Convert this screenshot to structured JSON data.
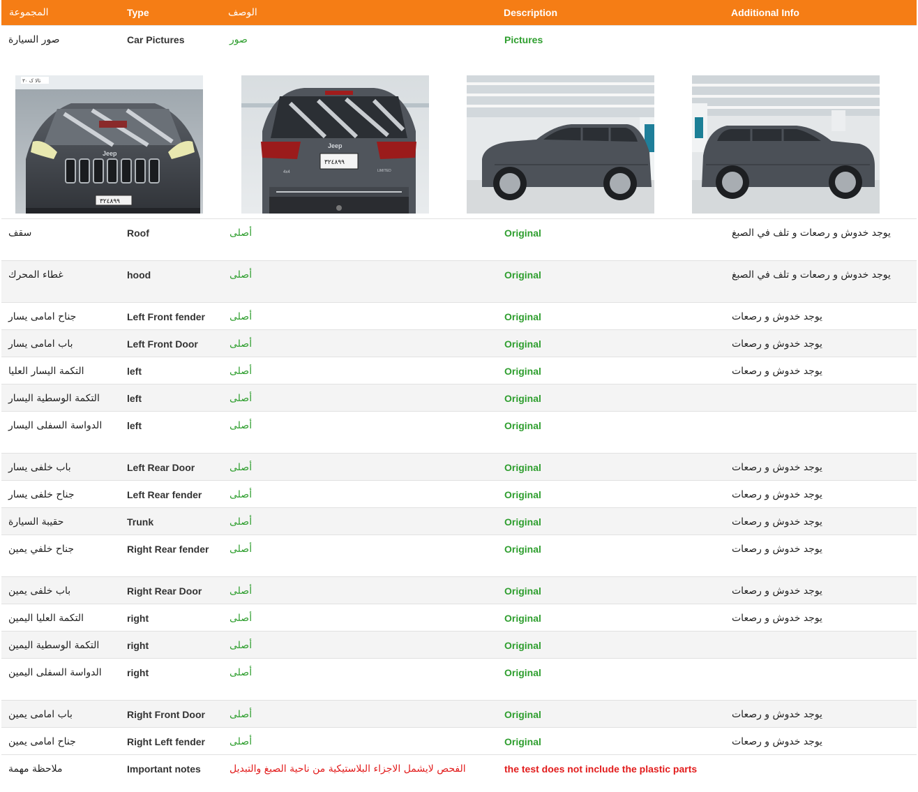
{
  "header": {
    "col_group": "المجموعة",
    "col_type": "Type",
    "col_desc_ar": "الوصف",
    "col_desc_en": "Description",
    "col_info": "Additional Info"
  },
  "pictures_row": {
    "group": "صور السيارة",
    "type": "Car Pictures",
    "desc_ar": "صور",
    "desc_en": "Pictures"
  },
  "photos": {
    "front": {
      "badge": "Jeep",
      "plate": "٣٢٤٨٩٩",
      "corner_text": "تالا ک ٣٠"
    },
    "rear": {
      "badge": "Jeep",
      "plate": "٣٢٤٨٩٩",
      "trim_4x4": "4x4",
      "trim_limited": "LIMITED"
    }
  },
  "rows": [
    {
      "group": "سقف",
      "type": "Roof",
      "desc_ar": "أصلى",
      "desc_en": "Original",
      "info": "يوجد خدوش و رصعات و تلف في الصبغ"
    },
    {
      "group": "غطاء المحرك",
      "type": "hood",
      "desc_ar": "أصلى",
      "desc_en": "Original",
      "info": "يوجد خدوش و رصعات و تلف في الصبغ"
    },
    {
      "group": "جناح امامى يسار",
      "type": "Left Front fender",
      "desc_ar": "أصلى",
      "desc_en": "Original",
      "info": "يوجد خدوش و رصعات"
    },
    {
      "group": "باب امامى يسار",
      "type": "Left Front Door",
      "desc_ar": "أصلى",
      "desc_en": "Original",
      "info": "يوجد خدوش و رصعات"
    },
    {
      "group": "التكمة اليسار العليا",
      "type": "left",
      "desc_ar": "أصلى",
      "desc_en": "Original",
      "info": "يوجد خدوش و رصعات"
    },
    {
      "group": "التكمة الوسطية اليسار",
      "type": "left",
      "desc_ar": "أصلى",
      "desc_en": "Original",
      "info": ""
    },
    {
      "group": "الدواسة السفلى اليسار",
      "type": "left",
      "desc_ar": "أصلى",
      "desc_en": "Original",
      "info": ""
    },
    {
      "group": "باب خلفى يسار",
      "type": "Left Rear Door",
      "desc_ar": "أصلى",
      "desc_en": "Original",
      "info": "يوجد خدوش و رصعات"
    },
    {
      "group": "جناح خلفى يسار",
      "type": "Left Rear fender",
      "desc_ar": "أصلى",
      "desc_en": "Original",
      "info": "يوجد خدوش و رصعات"
    },
    {
      "group": "حقيبة السيارة",
      "type": "Trunk",
      "desc_ar": "أصلى",
      "desc_en": "Original",
      "info": "يوجد خدوش و رصعات"
    },
    {
      "group": "جناح خلفي يمين",
      "type": "Right Rear fender",
      "desc_ar": "أصلى",
      "desc_en": "Original",
      "info": "يوجد خدوش و رصعات"
    },
    {
      "group": "باب خلفى يمين",
      "type": "Right Rear Door",
      "desc_ar": "أصلى",
      "desc_en": "Original",
      "info": "يوجد خدوش و رصعات"
    },
    {
      "group": "التكمة العليا اليمين",
      "type": "right",
      "desc_ar": "أصلى",
      "desc_en": "Original",
      "info": "يوجد خدوش و رصعات"
    },
    {
      "group": "التكمة الوسطية اليمين",
      "type": "right",
      "desc_ar": "أصلى",
      "desc_en": "Original",
      "info": ""
    },
    {
      "group": "الدواسة السفلى اليمين",
      "type": "right",
      "desc_ar": "أصلى",
      "desc_en": "Original",
      "info": ""
    },
    {
      "group": "باب امامى يمين",
      "type": "Right Front Door",
      "desc_ar": "أصلى",
      "desc_en": "Original",
      "info": "يوجد خدوش و رصعات"
    },
    {
      "group": "جناح امامى يمين",
      "type": "Right Left fender",
      "desc_ar": "أصلى",
      "desc_en": "Original",
      "info": "يوجد خدوش و رصعات"
    }
  ],
  "note_row": {
    "group": "ملاحظة مهمة",
    "type": "Important notes",
    "desc_ar": "الفحص لايشمل الاجزاء البلاستيكية من ناحية الصبغ والتبديل",
    "desc_en": "the test does not include the plastic parts",
    "info": ""
  }
}
